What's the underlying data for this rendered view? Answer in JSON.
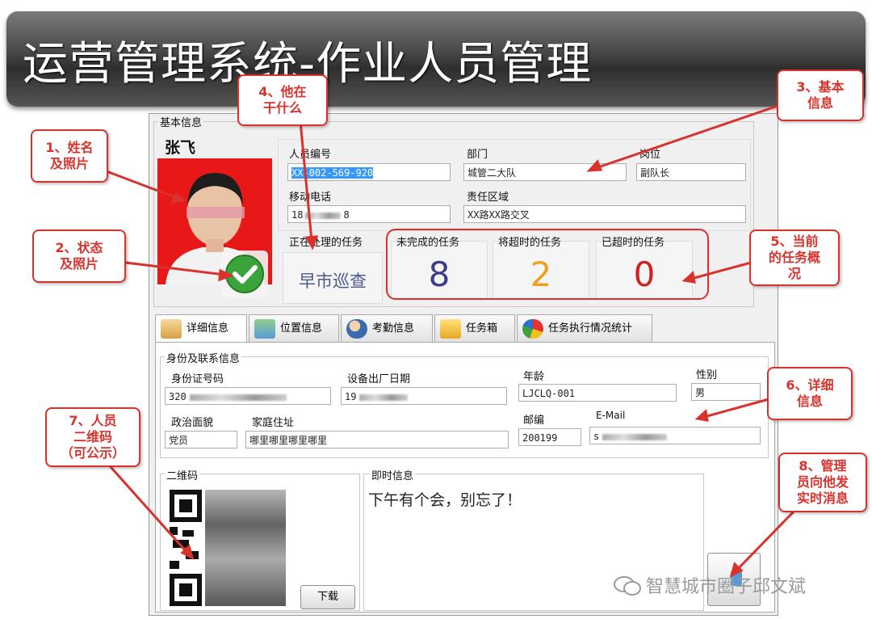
{
  "header": {
    "title": "运营管理系统-作业人员管理"
  },
  "basic": {
    "group_label": "基本信息",
    "name": "张飞",
    "fields": {
      "id_label": "人员编号",
      "id_value": "XX-002-569-920",
      "dept_label": "部门",
      "dept_value": "城管二大队",
      "post_label": "岗位",
      "post_value": "副队长",
      "phone_label": "移动电话",
      "phone_prefix": "18",
      "phone_suffix": "8",
      "area_label": "责任区域",
      "area_value": "XX路XX路交叉"
    },
    "current_label": "正在处理的任务",
    "current_task": "早市巡查"
  },
  "counters": [
    {
      "label": "未完成的任务",
      "value": "8",
      "color": "#3c3c8c"
    },
    {
      "label": "将超时的任务",
      "value": "2",
      "color": "#f0a020"
    },
    {
      "label": "已超时的任务",
      "value": "0",
      "color": "#d02020"
    }
  ],
  "tabs": [
    {
      "label": "详细信息"
    },
    {
      "label": "位置信息"
    },
    {
      "label": "考勤信息"
    },
    {
      "label": "任务箱"
    },
    {
      "label": "任务执行情况统计"
    }
  ],
  "detail": {
    "group_label": "身份及联系信息",
    "idcard_label": "身份证号码",
    "idcard_value": "320",
    "device_date_label": "设备出厂日期",
    "device_date_value": "19",
    "age_label": "年龄",
    "age_value": "LJCLQ-001",
    "gender_label": "性别",
    "gender_value": "男",
    "political_label": "政治面貌",
    "political_value": "党员",
    "address_label": "家庭住址",
    "address_value": "哪里哪里哪里哪里",
    "zip_label": "邮编",
    "zip_value": "200199",
    "email_label": "E-Mail",
    "email_value": "s"
  },
  "qr": {
    "label": "二维码",
    "download": "下载"
  },
  "message": {
    "label": "即时信息",
    "text": "下午有个会，别忘了！"
  },
  "callouts": [
    {
      "text": "1、姓名\n及照片"
    },
    {
      "text": "2、状态\n及照片"
    },
    {
      "text": "3、基本\n信息"
    },
    {
      "text": "4、他在\n干什么"
    },
    {
      "text": "5、当前\n的任务概\n况"
    },
    {
      "text": "6、详细\n信息"
    },
    {
      "text": "7、人员\n二维码\n（可公示）"
    },
    {
      "text": "8、管理\n员向他发\n实时消息"
    }
  ],
  "watermark": "智慧城市圈子邱文斌",
  "colors": {
    "callout": "#d9322d",
    "photo_bg": "#e81818",
    "status_ok": "#3aa43a"
  }
}
